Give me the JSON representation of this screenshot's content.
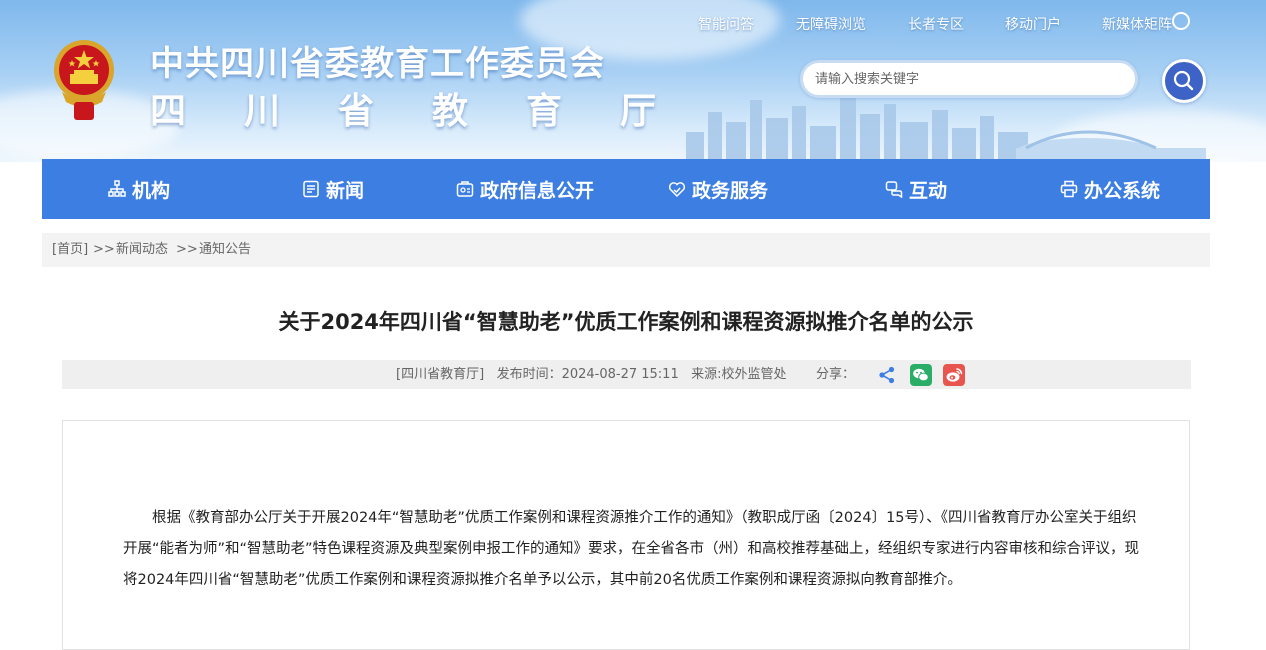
{
  "header": {
    "title": "中共四川省委教育工作委员会",
    "subtitle": "四川省教育厅",
    "top_links": [
      "智能问答",
      "无障碍浏览",
      "长者专区",
      "移动门户",
      "新媒体矩阵"
    ],
    "search": {
      "placeholder": "请输入搜索关键字",
      "value": ""
    }
  },
  "nav": {
    "items": [
      {
        "label": "机构",
        "icon": "org-chart-icon"
      },
      {
        "label": "新闻",
        "icon": "news-icon"
      },
      {
        "label": "政府信息公开",
        "icon": "info-disclosure-icon"
      },
      {
        "label": "政务服务",
        "icon": "service-heart-icon"
      },
      {
        "label": "互动",
        "icon": "chat-icon"
      },
      {
        "label": "办公系统",
        "icon": "printer-icon"
      }
    ]
  },
  "breadcrumb": {
    "home": "[首页]",
    "sep": ">>",
    "level1": "新闻动态",
    "level2": "通知公告"
  },
  "article": {
    "title": "关于2024年四川省“智慧助老”优质工作案例和课程资源拟推介名单的公示",
    "source_tag": "[四川省教育厅]",
    "publish_time": "发布时间：2024-08-27 15:11",
    "origin": "来源:校外监管处",
    "share_label": "分享：",
    "body": "根据《教育部办公厅关于开展2024年“智慧助老”优质工作案例和课程资源推介工作的通知》（教职成厅函〔2024〕15号）、《四川省教育厅办公室关于组织开展“能者为师”和“智慧助老”特色课程资源及典型案例申报工作的通知》要求，在全省各市（州）和高校推荐基础上，经组织专家进行内容审核和综合评议，现将2024年四川省“智慧助老”优质工作案例和课程资源拟推介名单予以公示，其中前20名优质工作案例和课程资源拟向教育部推介。"
  },
  "colors": {
    "nav_bg": "#3d7ee3",
    "search_button": "#3d63c7",
    "wechat": "#2aae67",
    "weibo": "#e8554e",
    "share_blue": "#3d7ee3"
  }
}
